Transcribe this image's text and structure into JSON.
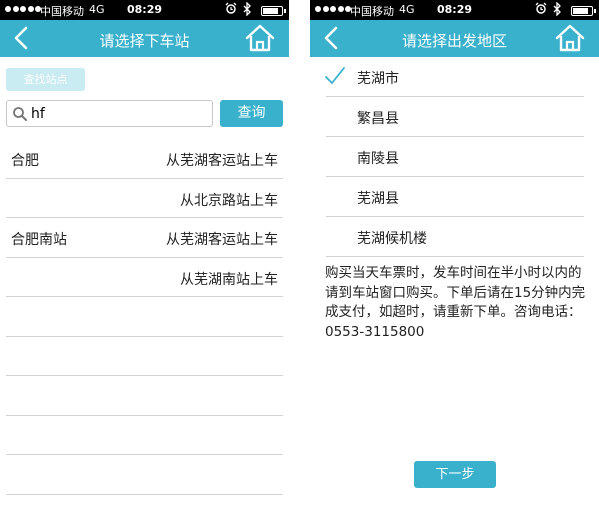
{
  "status": {
    "carrier": "中国移动",
    "network": "4G",
    "time": "08:29"
  },
  "left_screen": {
    "title": "请选择下车站",
    "find_button": "查找站点",
    "search": {
      "value": "hf",
      "placeholder": ""
    },
    "query_button": "查询",
    "results": [
      {
        "name": "合肥",
        "board": "从芜湖客运站上车"
      },
      {
        "name": "",
        "board": "从北京路站上车"
      },
      {
        "name": "合肥南站",
        "board": "从芜湖客运站上车"
      },
      {
        "name": "",
        "board": "从芜湖南站上车"
      },
      {
        "name": "",
        "board": ""
      },
      {
        "name": "",
        "board": ""
      },
      {
        "name": "",
        "board": ""
      },
      {
        "name": "",
        "board": ""
      },
      {
        "name": "",
        "board": ""
      }
    ]
  },
  "right_screen": {
    "title": "请选择出发地区",
    "districts": [
      {
        "label": "芜湖市",
        "selected": true
      },
      {
        "label": "繁昌县",
        "selected": false
      },
      {
        "label": "南陵县",
        "selected": false
      },
      {
        "label": "芜湖县",
        "selected": false
      },
      {
        "label": "芜湖候机楼",
        "selected": false
      }
    ],
    "notice": "购买当天车票时，发车时间在半小时以内的请到车站窗口购买。下单后请在15分钟内完成支付，如超时，请重新下单。咨询电话：0553-3115800",
    "next_button": "下一步"
  },
  "colors": {
    "accent": "#39b1cc",
    "find_button_bg": "#c9ebf2",
    "status_bar": "#000000",
    "divider": "#d4d4d4"
  },
  "icons": {
    "back": "chevron-left-icon",
    "home": "home-icon",
    "search": "magnifier-icon",
    "check": "checkmark-icon"
  }
}
